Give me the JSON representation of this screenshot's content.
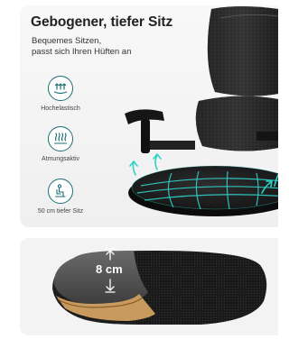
{
  "header": {
    "title": "Gebogener, tiefer Sitz",
    "subtitle_line1": "Bequemes Sitzen,",
    "subtitle_line2": "passt sich Ihren Hüften an"
  },
  "features": [
    {
      "icon": "elastic-arrows-icon",
      "label": "Hochelastisch"
    },
    {
      "icon": "breathable-airflow-icon",
      "label": "Atmungsaktiv"
    },
    {
      "icon": "seated-person-icon",
      "label": "50 cm tiefer Sitz"
    }
  ],
  "cushion": {
    "thickness_label": "8 cm"
  },
  "colors": {
    "accent": "#1a6f75",
    "glow": "#2fd3c8",
    "mesh": "#1c1c1c"
  }
}
